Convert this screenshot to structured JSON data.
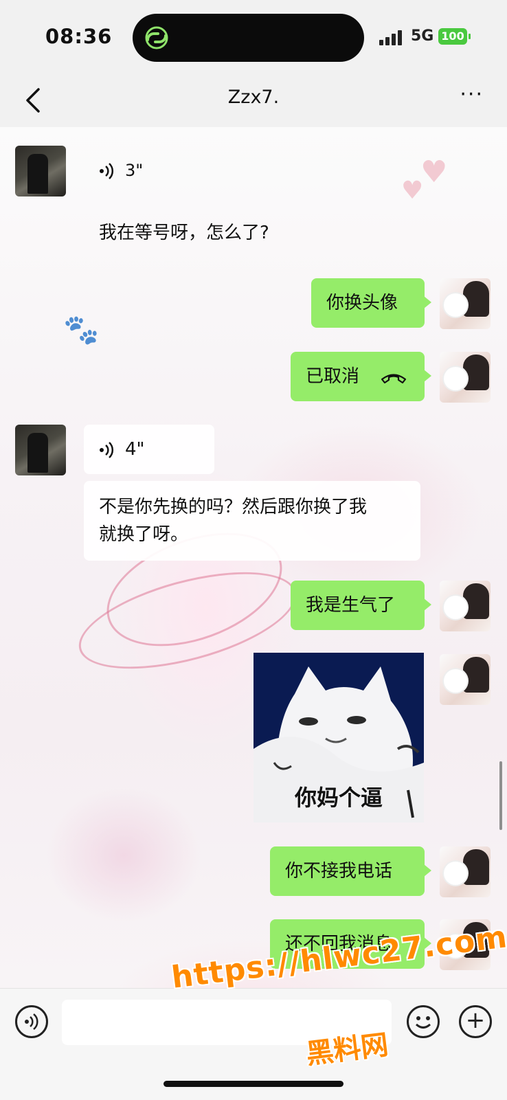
{
  "status_bar": {
    "time": "08:36",
    "network": "5G",
    "battery": "100",
    "icons": [
      "app-logo-icon",
      "signal-icon",
      "battery-icon"
    ]
  },
  "header": {
    "back_icon": "chevron-left-icon",
    "title": "Zzx7.",
    "more_icon": "more-dots-icon"
  },
  "messages": [
    {
      "side": "left",
      "type": "voice",
      "duration": "3\""
    },
    {
      "side": "left",
      "type": "text",
      "text": "我在等号呀，怎么了?"
    },
    {
      "side": "right",
      "type": "text",
      "text": "你换头像"
    },
    {
      "side": "right",
      "type": "call",
      "text": "已取消",
      "icon": "hang-up-icon"
    },
    {
      "side": "left",
      "type": "voice",
      "duration": "4\""
    },
    {
      "side": "left",
      "type": "text",
      "lines": [
        "不是你先换的吗？然后跟你换了我",
        "就换了呀。"
      ]
    },
    {
      "side": "right",
      "type": "text",
      "text": "我是生气了"
    },
    {
      "side": "right",
      "type": "sticker",
      "caption": "你妈个逼"
    },
    {
      "side": "right",
      "type": "text",
      "text": "你不接我电话"
    },
    {
      "side": "right",
      "type": "text",
      "text": "还不回我消息"
    }
  ],
  "input_bar": {
    "voice_icon": "voice-input-icon",
    "emoji_icon": "emoji-icon",
    "plus_icon": "plus-icon"
  },
  "watermark": {
    "url": "https://hlwc27.com",
    "label": "黑料网"
  },
  "colors": {
    "outgoing_bubble": "#95ec69",
    "incoming_bubble": "#ffffff",
    "watermark": "#ff8a00",
    "battery": "#4ac93f"
  }
}
